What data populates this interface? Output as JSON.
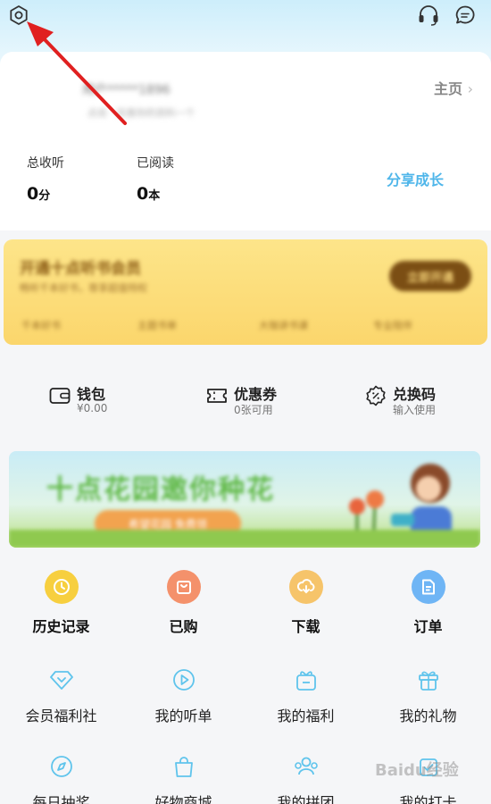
{
  "profile": {
    "username": "用户*****1896",
    "hint": "点击 · 完善你的资料一个",
    "homepage_label": "主页",
    "stats": [
      {
        "label": "总收听",
        "value": "0",
        "unit": "分"
      },
      {
        "label": "已阅读",
        "value": "0",
        "unit": "本"
      }
    ],
    "share_label": "分享成长"
  },
  "vip": {
    "title": "开通十点听书会员",
    "subtitle": "畅听千本好书，尊享超值特权",
    "button": "立即开通",
    "perks": [
      "千本好书",
      "主题书单",
      "大咖讲书课",
      "专业陪伴"
    ]
  },
  "wallet": [
    {
      "title": "钱包",
      "sub": "¥0.00",
      "icon": "wallet-icon"
    },
    {
      "title": "优惠券",
      "sub": "0张可用",
      "icon": "coupon-icon"
    },
    {
      "title": "兑换码",
      "sub": "输入使用",
      "icon": "redeem-icon"
    }
  ],
  "promo": {
    "title": "十点花园邀你种花",
    "button": "希望花园 免费领"
  },
  "main_actions": [
    {
      "label": "历史记录",
      "icon": "clock-icon",
      "color": "#f7cf3f"
    },
    {
      "label": "已购",
      "icon": "bag-icon",
      "color": "#f4916b"
    },
    {
      "label": "下载",
      "icon": "download-icon",
      "color": "#f6c46a"
    },
    {
      "label": "订单",
      "icon": "document-icon",
      "color": "#6fb5f5"
    }
  ],
  "services_row1": [
    {
      "label": "会员福利社",
      "icon": "diamond-icon"
    },
    {
      "label": "我的听单",
      "icon": "play-icon"
    },
    {
      "label": "我的福利",
      "icon": "gift-box-icon"
    },
    {
      "label": "我的礼物",
      "icon": "present-icon"
    }
  ],
  "services_row2": [
    {
      "label": "每日抽奖",
      "icon": "compass-icon"
    },
    {
      "label": "好物商城",
      "icon": "shopping-bag-icon"
    },
    {
      "label": "我的拼团",
      "icon": "group-icon"
    },
    {
      "label": "我的打卡",
      "icon": "checkin-icon"
    }
  ],
  "watermark": "Baidu经验",
  "accent_color": "#4fb6ea"
}
